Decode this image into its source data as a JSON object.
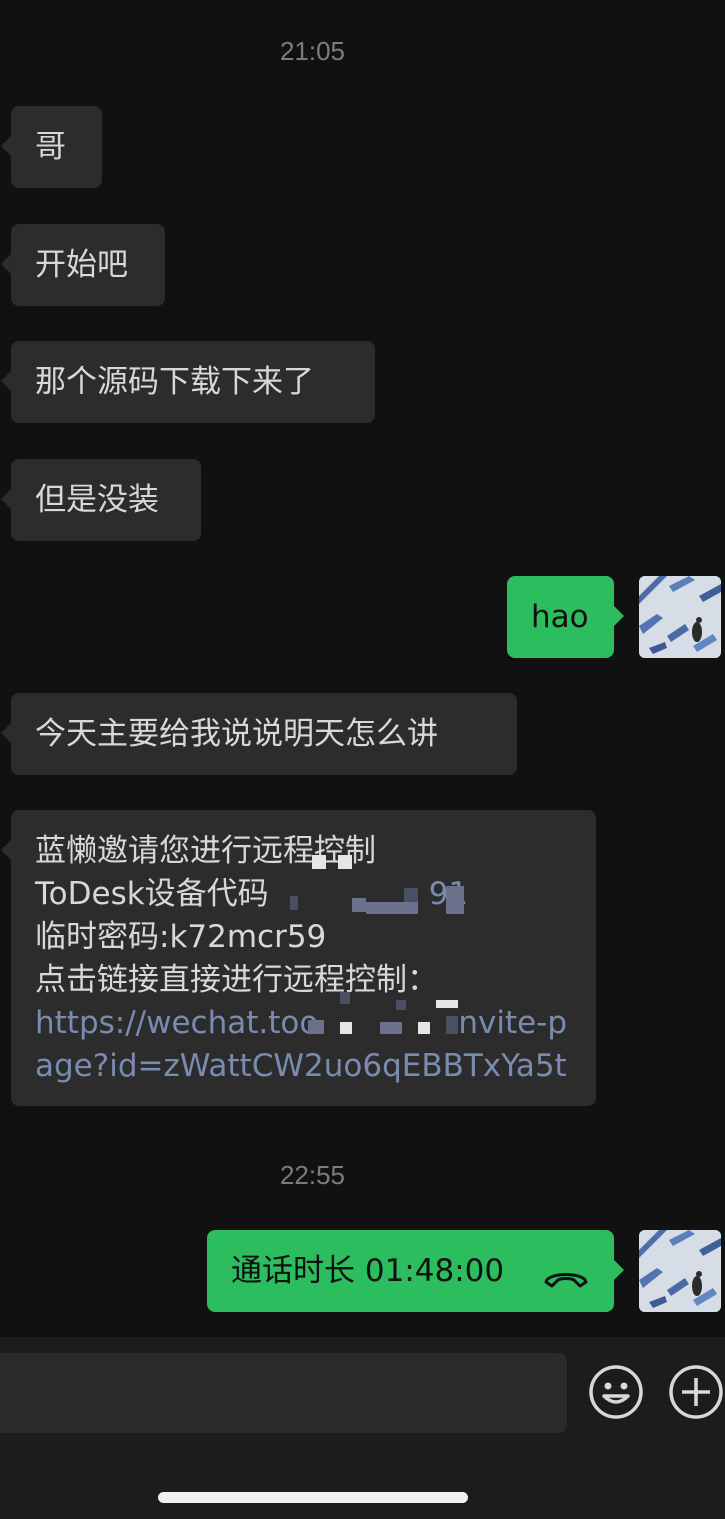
{
  "chat": {
    "timestamps": [
      "21:05",
      "22:55"
    ],
    "messages_in": [
      "哥",
      "开始吧",
      "那个源码下载下来了",
      "但是没装",
      "今天主要给我说说明天怎么讲"
    ],
    "reply_out": "hao",
    "invite": {
      "line1": "蓝懒邀请您进行远程控制",
      "line2_prefix": "ToDesk设备代码",
      "line2_suffix": "91",
      "line3": "临时密码:k72mcr59",
      "line4": "点击链接直接进行远程控制：",
      "link_line1_prefix": "https://wechat.too",
      "link_line1_suffix": "nvite-p",
      "link_line2": "age?id=zWattCW2uo6qEBBTxYa5t"
    },
    "call": {
      "label": "通话时长 01:48:00",
      "icon": "hangup-phone-icon"
    }
  },
  "input_bar": {
    "emoji_icon": "emoji-icon",
    "plus_icon": "plus-icon"
  },
  "colors": {
    "background": "#111111",
    "incoming_bubble": "#2c2c2c",
    "outgoing_bubble": "#2bbd5e",
    "link": "#7a8bb0"
  }
}
